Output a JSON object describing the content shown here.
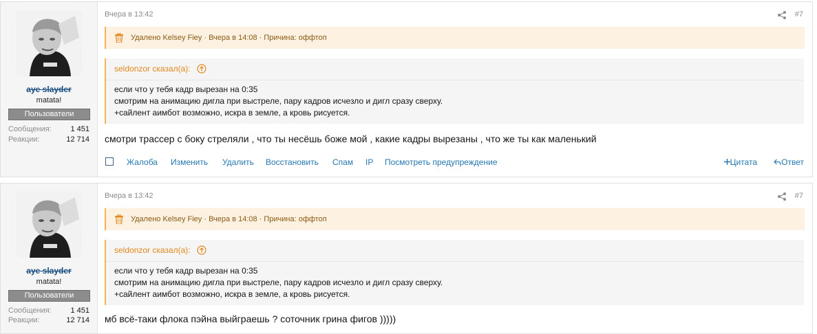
{
  "posts": [
    {
      "author": "aye slayder",
      "user_title": "matata!",
      "banner": "Пользователи",
      "stats": [
        {
          "label": "Сообщения:",
          "value": "1 451"
        },
        {
          "label": "Реакции:",
          "value": "12 714"
        }
      ],
      "date": "Вчера в 13:42",
      "number": "#7",
      "deleted_notice": "Удалено Kelsey Fiey · Вчера в 14:08 · Причина: оффтоп",
      "quote": {
        "attribution": "seldonzor сказал(а):",
        "lines": [
          "если что у тебя кадр вырезан на 0:35",
          "смотрим на анимацию дигла при выстреле, пару кадров исчезло и дигл сразу сверху.",
          "+сайлент аимбот возможно, искра в земле, а кровь рисуется."
        ]
      },
      "message": "смотри трассер с боку стреляли , что ты несёшь боже мой , какие кадры вырезаны , что же ты как маленький",
      "actions": [
        "Жалоба",
        "Изменить",
        "Удалить",
        "Восстановить",
        "Спам",
        "IP",
        "Посмотреть предупреждение"
      ],
      "quote_action": "Цитата",
      "reply_action": "Ответ"
    },
    {
      "author": "aye slayder",
      "user_title": "matata!",
      "banner": "Пользователи",
      "stats": [
        {
          "label": "Сообщения:",
          "value": "1 451"
        },
        {
          "label": "Реакции:",
          "value": "12 714"
        }
      ],
      "date": "Вчера в 13:42",
      "number": "#7",
      "deleted_notice": "Удалено Kelsey Fiey · Вчера в 14:08 · Причина: оффтоп",
      "quote": {
        "attribution": "seldonzor сказал(а):",
        "lines": [
          "если что у тебя кадр вырезан на 0:35",
          "смотрим на анимацию дигла при выстреле, пару кадров исчезло и дигл сразу сверху.",
          "+сайлент аимбот возможно, искра в земле, а кровь рисуется."
        ]
      },
      "message": "мб всё-таки флока пэйна выйграешь ? соточник грина фигов )))))"
    }
  ],
  "colors": {
    "accent": "#2577b1",
    "quote_accent": "#e3861a",
    "deleted_bg": "#fdf1e2",
    "banner_bg": "#8c8c8c"
  },
  "icons": [
    "share-icon",
    "trash-icon",
    "arrow-up-circle-icon",
    "plus-icon",
    "reply-arrow-icon"
  ]
}
